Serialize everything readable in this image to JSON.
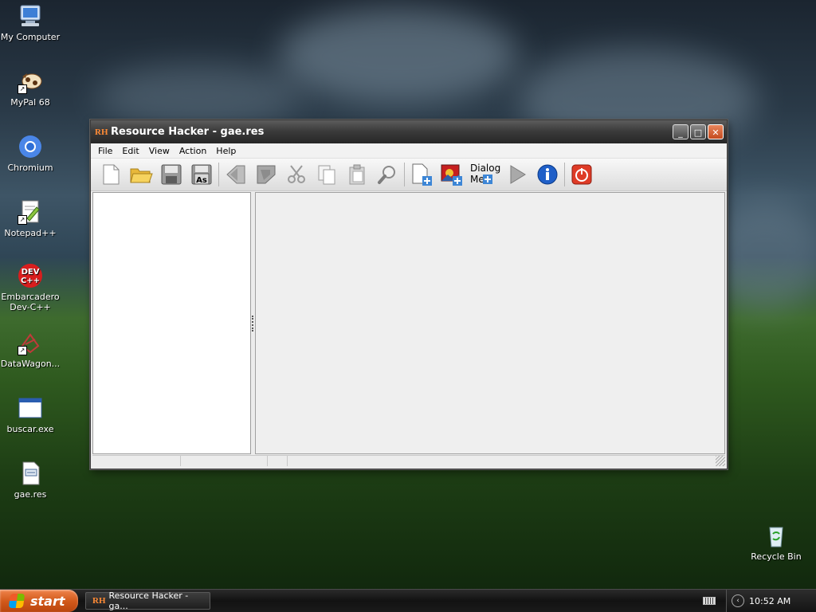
{
  "desktop": {
    "icons": [
      {
        "label": "My Computer"
      },
      {
        "label": "MyPal 68"
      },
      {
        "label": "Chromium"
      },
      {
        "label": "Notepad++"
      },
      {
        "label": "Embarcadero Dev-C++"
      },
      {
        "label": "DataWagon..."
      },
      {
        "label": "buscar.exe"
      },
      {
        "label": "gae.res"
      },
      {
        "label": "Recycle Bin"
      }
    ]
  },
  "window": {
    "app_icon_text": "RH",
    "title": "Resource Hacker - gae.res",
    "controls": {
      "minimize": "_",
      "maximize": "□",
      "close": "✕"
    },
    "menu": [
      "File",
      "Edit",
      "View",
      "Action",
      "Help"
    ],
    "toolbar": {
      "buttons": [
        {
          "name": "new-icon"
        },
        {
          "name": "open-folder-icon"
        },
        {
          "name": "save-icon"
        },
        {
          "name": "save-as-icon",
          "text": "As"
        },
        {
          "name": "back-arrow-icon"
        },
        {
          "name": "forward-arrow-icon"
        },
        {
          "name": "cut-icon"
        },
        {
          "name": "copy-icon"
        },
        {
          "name": "paste-icon"
        },
        {
          "name": "find-icon"
        },
        {
          "name": "add-resource-icon"
        },
        {
          "name": "add-image-icon"
        },
        {
          "name": "dialog-menu-icon",
          "text_top": "Dialog",
          "text_bottom": "Me"
        },
        {
          "name": "run-script-icon"
        },
        {
          "name": "info-icon"
        },
        {
          "name": "exit-icon"
        }
      ]
    }
  },
  "taskbar": {
    "start_label": "start",
    "task_label": "Resource Hacker - ga...",
    "task_icon_text": "RH",
    "clock": "10:52 AM"
  }
}
